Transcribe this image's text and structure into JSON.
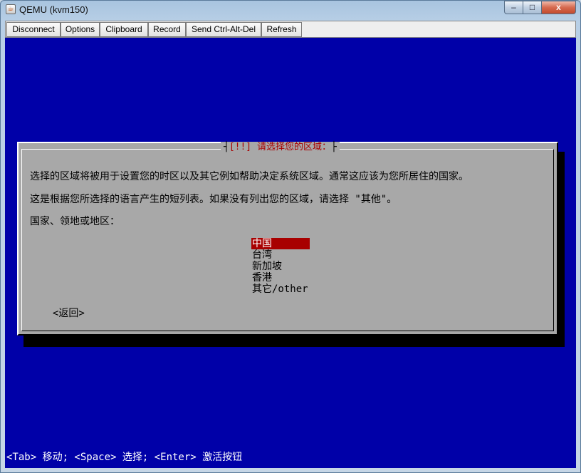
{
  "window": {
    "title": "QEMU (kvm150)",
    "controls": {
      "minimize": "–",
      "maximize": "□",
      "close": "x"
    }
  },
  "toolbar": {
    "disconnect": "Disconnect",
    "options": "Options",
    "clipboard": "Clipboard",
    "record": "Record",
    "send_cad": "Send Ctrl-Alt-Del",
    "refresh": "Refresh"
  },
  "dialog": {
    "title": "[!!] 请选择您的区域：",
    "line1": "选择的区域将被用于设置您的时区以及其它例如帮助决定系统区域。通常这应该为您所居住的国家。",
    "line2": "这是根据您所选择的语言产生的短列表。如果没有列出您的区域，请选择 \"其他\"。",
    "prompt": "国家、领地或地区：",
    "options": [
      "中国",
      "台湾",
      "新加坡",
      "香港",
      "其它/other"
    ],
    "selected_index": 0,
    "back": "<返回>"
  },
  "status_bar": "<Tab> 移动; <Space> 选择; <Enter> 激活按钮",
  "colors": {
    "console_bg": "#0000a8",
    "dialog_bg": "#a8a8a8",
    "highlight": "#a80000"
  }
}
